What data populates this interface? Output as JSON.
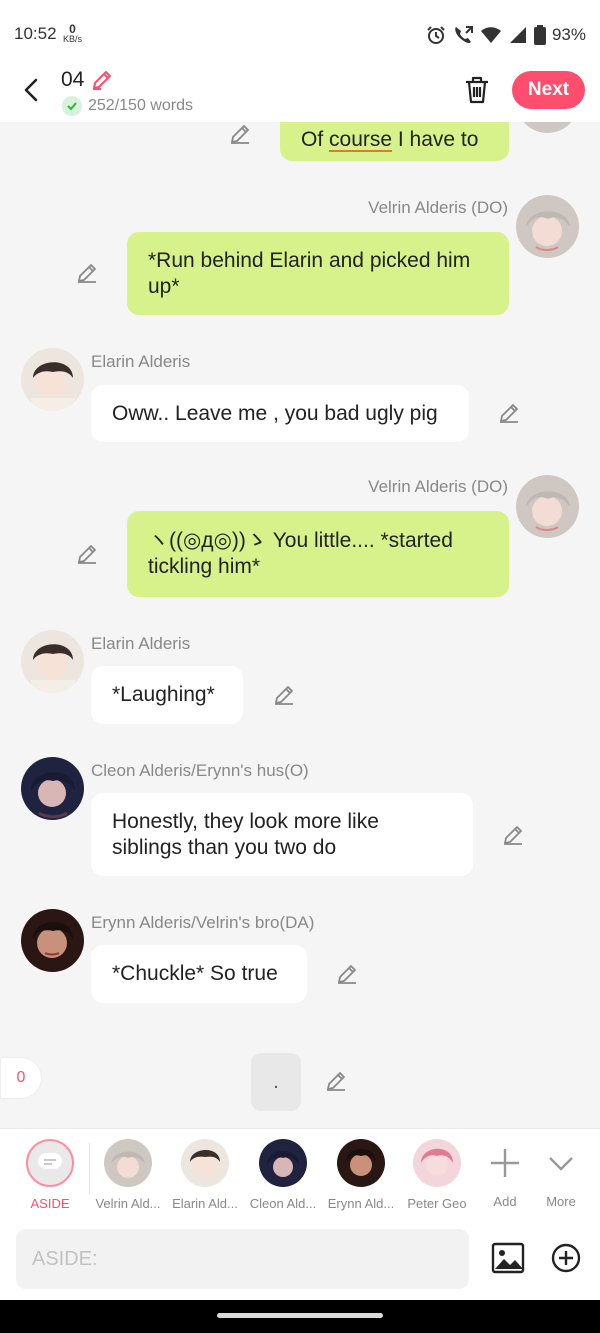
{
  "status_bar": {
    "time": "10:52",
    "net_speed_value": "0",
    "net_speed_unit": "KB/s",
    "battery": "93%"
  },
  "header": {
    "title": "04",
    "word_count": "252/150 words",
    "next_label": "Next"
  },
  "messages": [
    {
      "side": "right",
      "text_before": "Of ",
      "text_underlined": "course",
      "text_after": " I have to"
    },
    {
      "side": "right",
      "name": "Velrin Alderis (DO)",
      "text": "*Run behind Elarin and picked him up*"
    },
    {
      "side": "left",
      "name": "Elarin Alderis",
      "text": "Oww.. Leave me , you bad ugly pig"
    },
    {
      "side": "right",
      "name": "Velrin Alderis (DO)",
      "text": "ヽ((◎д◎))ゝ You little....  *started tickling him*"
    },
    {
      "side": "left",
      "name": "Elarin Alderis",
      "text": "*Laughing*"
    },
    {
      "side": "left",
      "name": "Cleon Alderis/Erynn's hus(O)",
      "text": "Honestly, they look more like siblings than you two do"
    },
    {
      "side": "left",
      "name": "Erynn Alderis/Velrin's bro(DA)",
      "text": "*Chuckle* So true"
    },
    {
      "side": "center",
      "text": "."
    }
  ],
  "unread_count": "0",
  "characters": [
    {
      "label": "ASIDE"
    },
    {
      "label": "Velrin Ald..."
    },
    {
      "label": "Elarin Ald..."
    },
    {
      "label": "Cleon Ald..."
    },
    {
      "label": "Erynn Ald..."
    },
    {
      "label": "Peter Geo"
    }
  ],
  "actions": {
    "add_label": "Add",
    "more_label": "More"
  },
  "input": {
    "placeholder": "ASIDE:"
  },
  "colors": {
    "accent": "#ff4d6d",
    "bubble_right": "#d7f28a",
    "bubble_left": "#ffffff",
    "background": "#f5f5f5"
  },
  "icons": [
    "back-arrow-icon",
    "pencil-icon",
    "check-icon",
    "trash-icon",
    "edit-icon",
    "image-icon",
    "add-circle-icon",
    "plus-icon",
    "chevron-down-icon",
    "alarm-icon",
    "call-icon",
    "wifi-icon",
    "signal-icon",
    "battery-icon"
  ]
}
